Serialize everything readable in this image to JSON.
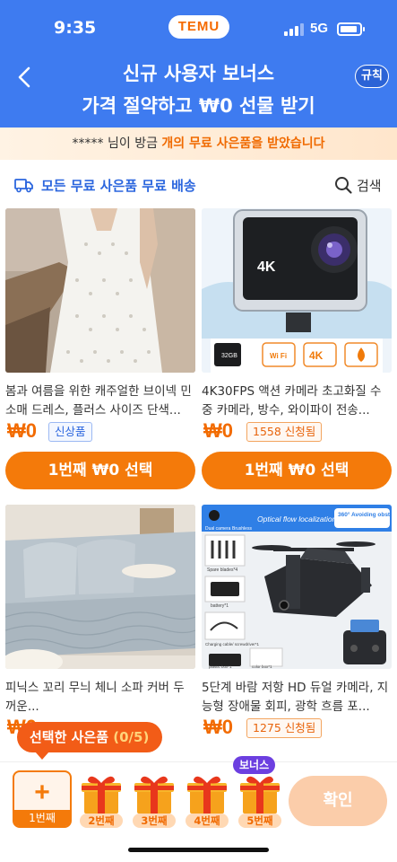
{
  "status_bar": {
    "time": "9:35",
    "brand": "TEMU",
    "network": "5G"
  },
  "header": {
    "title_line1": "신규 사용자 보너스",
    "title_line2": "가격 절약하고 ₩0 선물 받기",
    "rules_label": "규칙"
  },
  "notice": {
    "prefix": "***** 님이 방금 ",
    "highlight": "개의 무료 사은품을 받았습니다"
  },
  "filter_bar": {
    "free_shipping_label": "모든 무료 사은품 무료 배송",
    "search_label": "검색"
  },
  "products": [
    {
      "name": "봄과 여름을 위한 캐주얼한 브이넥 민소매 드레스, 플러스 사이즈 단색...",
      "price": "₩0",
      "badge": "신상품",
      "button": "1번째 ₩0 선택"
    },
    {
      "name": "4K30FPS 액션 카메라 초고화질 수중 카메라, 방수, 와이파이 전송...",
      "price": "₩0",
      "badge": "1558 신청됨",
      "button": "1번째 ₩0 선택",
      "image_labels": {
        "logo": "4K",
        "card": "32GB",
        "wifi": "Wi Fi",
        "res": "4K"
      }
    },
    {
      "name": "피닉스 꼬리 무늬 체니 소파 커버 두꺼운...",
      "price": "₩0",
      "badge": ""
    },
    {
      "name": "5단계 바람 저항 HD 듀얼 카메라, 지능형 장애물 회피, 광학 흐름 포...",
      "price": "₩0",
      "badge": "1275 신청됨",
      "image_labels": {
        "banner": "Optical flow localization",
        "tag": "360° Avoiding obstacles",
        "kit1": "Dual camera",
        "kit2": "Brushless",
        "spare": "Spare blades*4",
        "battery": "battery*1",
        "cable": "Charging cable/ screwdriver*1",
        "box": "plastic box*1",
        "color_box": "color box*1"
      }
    }
  ],
  "gift_tray": {
    "label": "선택한 사은품",
    "count": "(0/5)",
    "slots": [
      "1번째",
      "2번째",
      "3번째",
      "4번째",
      "5번째"
    ],
    "bonus_tag": "보너스",
    "confirm_label": "확인"
  },
  "colors": {
    "header_blue": "#3e7bf0",
    "accent_orange": "#f47a0a",
    "confirm_disabled": "#fbcdaa"
  }
}
